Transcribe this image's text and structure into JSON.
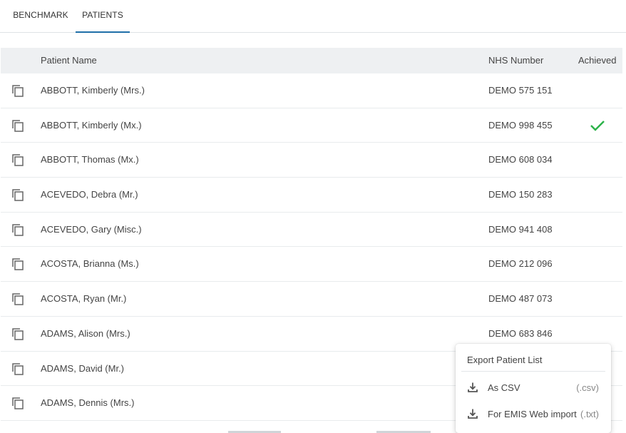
{
  "tabs": [
    {
      "label": "BENCHMARK",
      "active": false
    },
    {
      "label": "PATIENTS",
      "active": true
    }
  ],
  "table": {
    "headers": {
      "name": "Patient Name",
      "nhs": "NHS Number",
      "achieved": "Achieved"
    },
    "rows": [
      {
        "name": "ABBOTT, Kimberly (Mrs.)",
        "nhs": "DEMO 575 151",
        "achieved": false
      },
      {
        "name": "ABBOTT, Kimberly (Mx.)",
        "nhs": "DEMO 998 455",
        "achieved": true
      },
      {
        "name": "ABBOTT, Thomas (Mx.)",
        "nhs": "DEMO 608 034",
        "achieved": false
      },
      {
        "name": "ACEVEDO, Debra (Mr.)",
        "nhs": "DEMO 150 283",
        "achieved": false
      },
      {
        "name": "ACEVEDO, Gary (Misc.)",
        "nhs": "DEMO 941 408",
        "achieved": false
      },
      {
        "name": "ACOSTA, Brianna (Ms.)",
        "nhs": "DEMO 212 096",
        "achieved": false
      },
      {
        "name": "ACOSTA, Ryan (Mr.)",
        "nhs": "DEMO 487 073",
        "achieved": false
      },
      {
        "name": "ADAMS, Alison (Mrs.)",
        "nhs": "DEMO 683 846",
        "achieved": false
      },
      {
        "name": "ADAMS, David (Mr.)",
        "nhs": "",
        "achieved": false
      },
      {
        "name": "ADAMS, Dennis (Mrs.)",
        "nhs": "",
        "achieved": false
      }
    ]
  },
  "export_menu": {
    "title": "Export Patient List",
    "items": [
      {
        "label": "As CSV",
        "ext": "(.csv)",
        "icon": "download-icon"
      },
      {
        "label": "For EMIS Web import",
        "ext": "(.txt)",
        "icon": "download-icon"
      }
    ]
  },
  "colors": {
    "accent": "#1f6fa8",
    "check": "#2db34a",
    "header_bg": "#eef0f2"
  }
}
